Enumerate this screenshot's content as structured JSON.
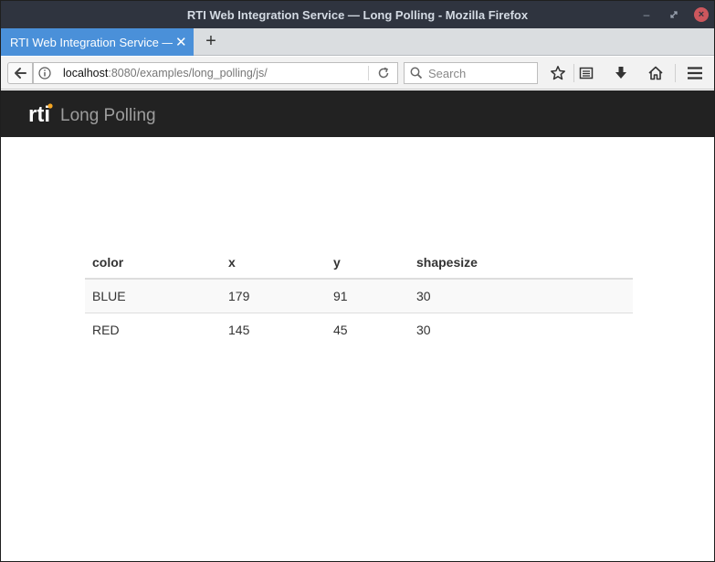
{
  "window": {
    "title": "RTI Web Integration Service — Long Polling - Mozilla Firefox"
  },
  "tabs": [
    {
      "label": "RTI Web Integration Service — Long Polling"
    }
  ],
  "newtab_label": "+",
  "urlbar": {
    "host": "localhost",
    "rest": ":8080/examples/long_polling/js/"
  },
  "search": {
    "placeholder": "Search"
  },
  "app": {
    "logo_text": "rti",
    "title": "Long Polling"
  },
  "table": {
    "headers": [
      "color",
      "x",
      "y",
      "shapesize"
    ],
    "rows": [
      [
        "BLUE",
        "179",
        "91",
        "30"
      ],
      [
        "RED",
        "145",
        "45",
        "30"
      ]
    ]
  },
  "colors": {
    "tab_active": "#4a90d9",
    "appbar": "#222222",
    "logo_dot": "#f5a623"
  }
}
